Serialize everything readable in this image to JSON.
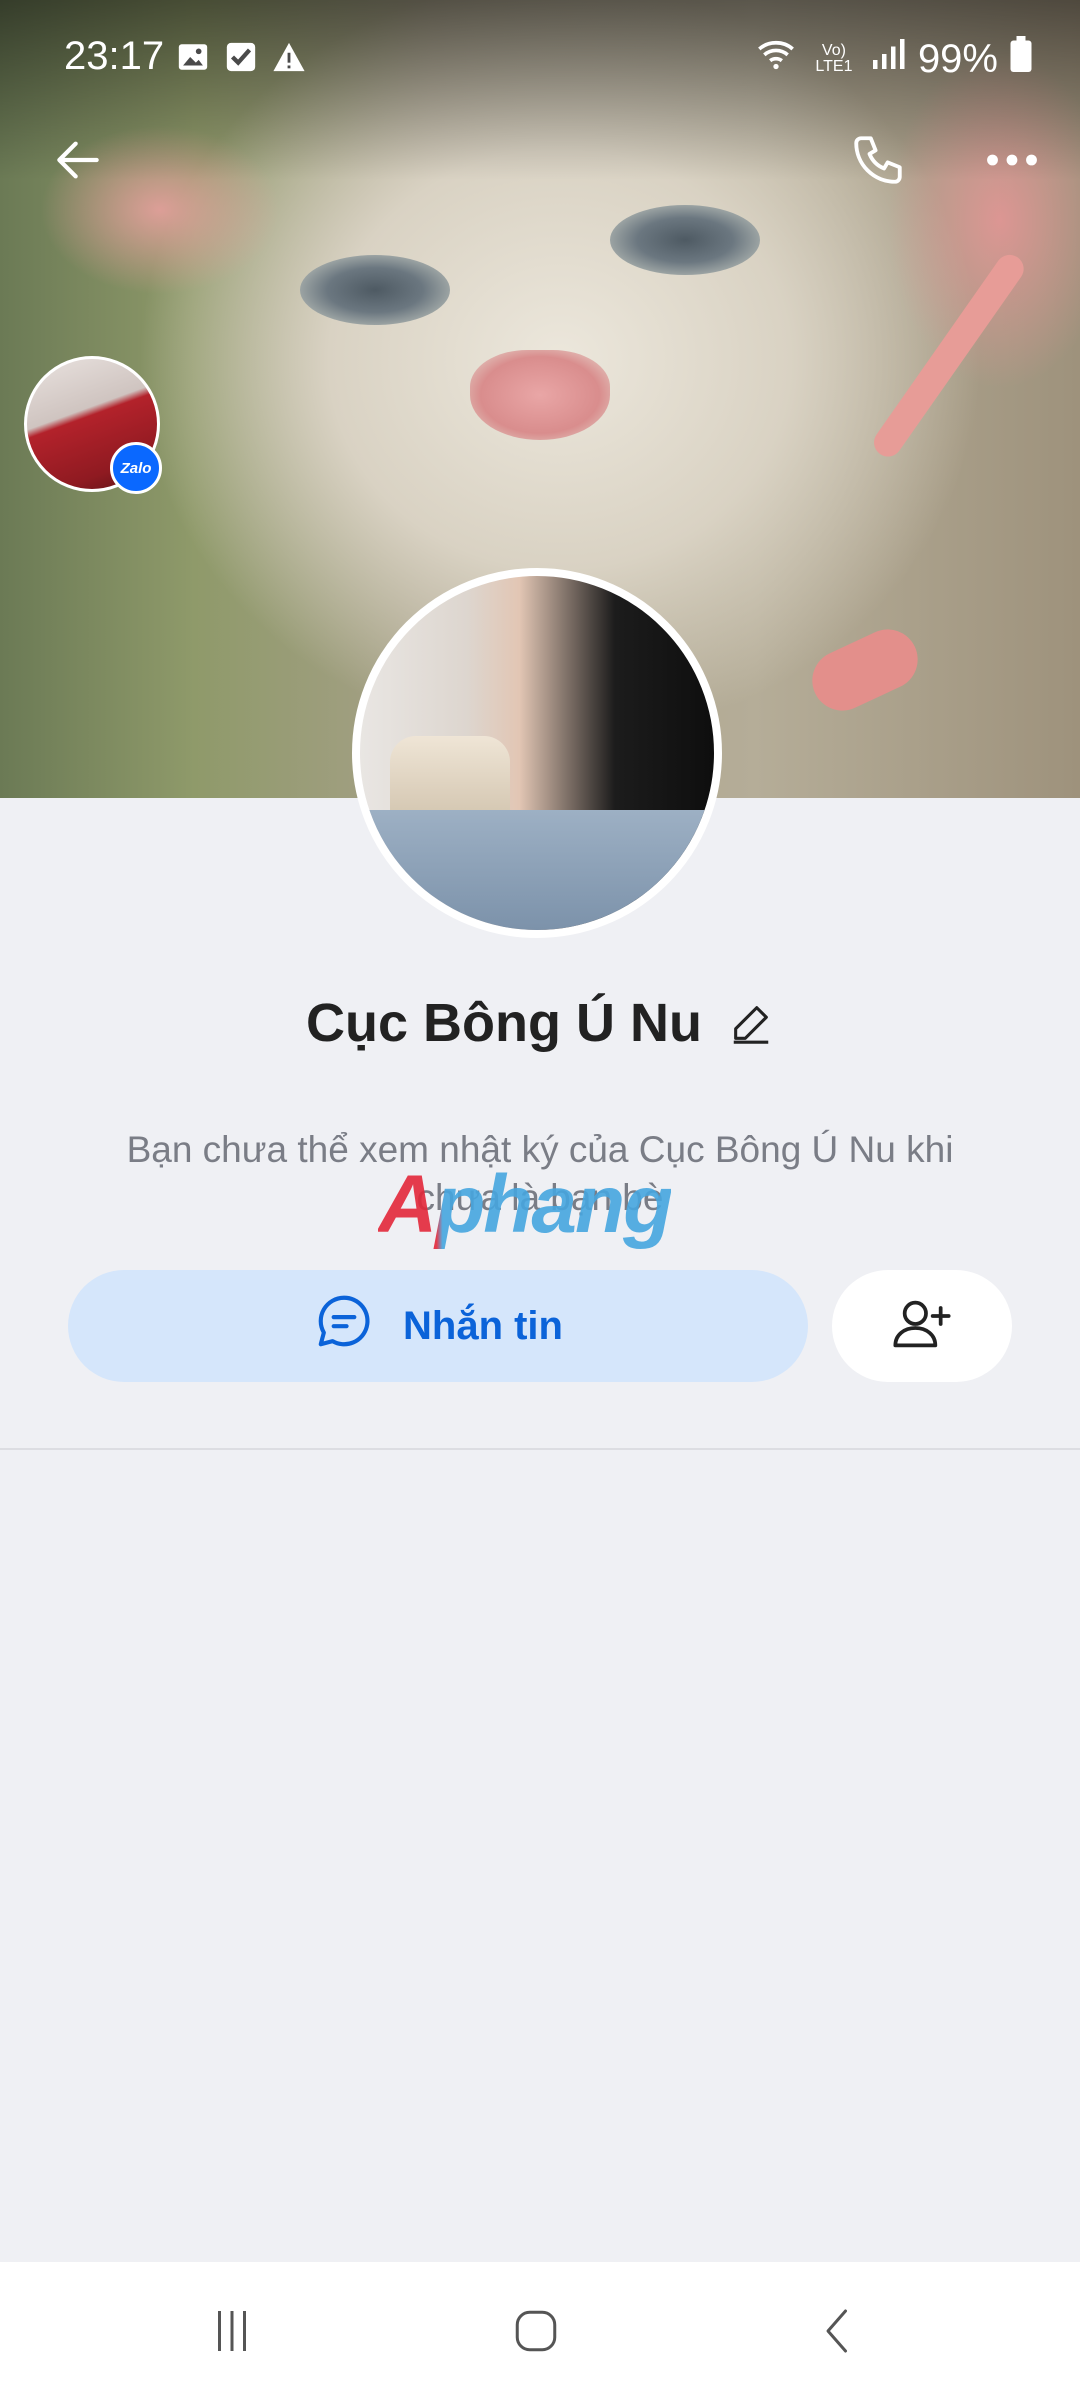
{
  "status_bar": {
    "time": "23:17",
    "battery": "99%",
    "network_label": "Vo) LTE1",
    "icons": [
      "image-icon",
      "checkbox-icon",
      "warning-icon",
      "wifi-icon",
      "volte-icon",
      "signal-icon",
      "battery-icon"
    ]
  },
  "top_bar": {
    "icons": [
      "back-arrow-icon",
      "phone-icon",
      "more-icon"
    ]
  },
  "profile": {
    "name": "Cục Bông Ú Nu",
    "badge_label": "Zalo",
    "notice": "Bạn chưa thể xem nhật ký của Cục Bông Ú Nu khi chưa là bạn bè"
  },
  "watermark": {
    "text": "Aphang"
  },
  "actions": {
    "message_label": "Nhắn tin",
    "add_friend_icon": "add-friend-icon"
  },
  "colors": {
    "accent": "#0b63d9",
    "button_bg": "#d5e6fb",
    "page_bg": "#eff0f4",
    "name_text": "#222222",
    "notice_text": "#7a7d86"
  },
  "nav_bar": {
    "icons": [
      "recent-apps-icon",
      "home-icon",
      "back-icon"
    ]
  }
}
